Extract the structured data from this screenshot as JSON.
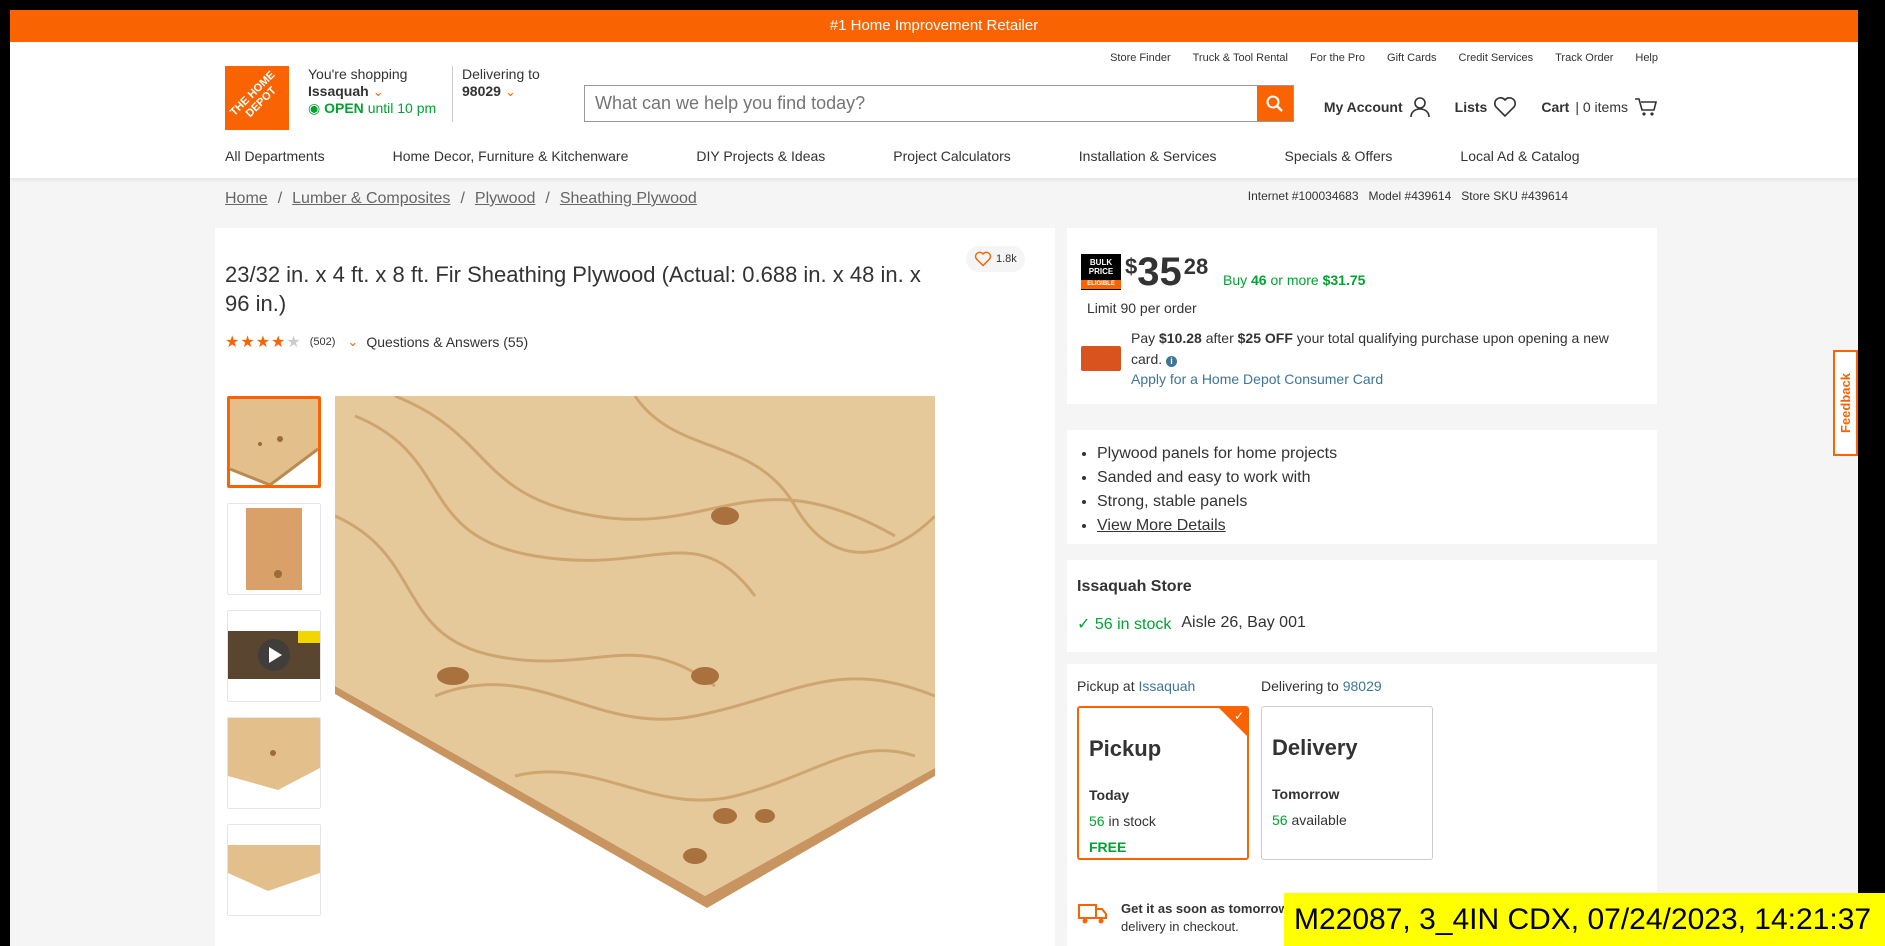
{
  "promo_banner": "#1 Home Improvement Retailer",
  "header": {
    "logo_text": "THE HOME DEPOT",
    "store": {
      "label": "You're shopping",
      "name": "Issaquah",
      "open": "OPEN",
      "hours": "until 10 pm"
    },
    "delivery": {
      "label": "Delivering to",
      "zip": "98029"
    },
    "search_placeholder": "What can we help you find today?",
    "utility_links": [
      "Store Finder",
      "Truck & Tool Rental",
      "For the Pro",
      "Gift Cards",
      "Credit Services",
      "Track Order",
      "Help"
    ],
    "my_account": "My Account",
    "lists": "Lists",
    "cart_label": "Cart",
    "cart_count": "| 0 items"
  },
  "nav": [
    "All Departments",
    "Home Decor, Furniture & Kitchenware",
    "DIY Projects & Ideas",
    "Project Calculators",
    "Installation & Services",
    "Specials & Offers",
    "Local Ad & Catalog"
  ],
  "breadcrumb": [
    "Home",
    "Lumber & Composites",
    "Plywood",
    "Sheathing Plywood"
  ],
  "skus": {
    "internet": "Internet #100034683",
    "model": "Model #439614",
    "store": "Store SKU #439614"
  },
  "product": {
    "title": "23/32 in. x 4 ft. x 8 ft. Fir Sheathing Plywood (Actual: 0.688 in. x 48 in. x 96 in.)",
    "favorites": "1.8k",
    "rating": 4,
    "review_count": "(502)",
    "qa": "Questions & Answers (55)"
  },
  "price": {
    "bulk_badge": [
      "BULK",
      "PRICE",
      "ELIGIBLE"
    ],
    "currency": "$",
    "dollars": "35",
    "cents": "28",
    "bulk_offer_prefix": "Buy",
    "bulk_qty": "46",
    "bulk_offer_mid": "or more",
    "bulk_price": "$31.75",
    "limit": "Limit 90 per order",
    "cc_pay": "Pay",
    "cc_amount": "$10.28",
    "cc_after": "after",
    "cc_off": "$25 OFF",
    "cc_rest": "your total qualifying purchase upon opening a new card.",
    "cc_link": "Apply for a Home Depot Consumer Card"
  },
  "bullets": [
    "Plywood panels for home projects",
    "Sanded and easy to work with",
    "Strong, stable panels"
  ],
  "view_more": "View More Details",
  "store_card": {
    "name": "Issaquah Store",
    "stock": "56 in stock",
    "aisle": "Aisle 26, Bay 001"
  },
  "fulfillment": {
    "pickup_label": "Pickup at",
    "pickup_store": "Issaquah",
    "delivery_label": "Delivering to",
    "delivery_zip": "98029",
    "pickup": {
      "title": "Pickup",
      "when": "Today",
      "count": "56",
      "count_suffix": "in stock",
      "cost": "FREE"
    },
    "delivery": {
      "title": "Delivery",
      "when": "Tomorrow",
      "count": "56",
      "count_suffix": "available"
    },
    "fast_bold": "Get it as soon as tomorrow",
    "fast_rest": "delivery in checkout."
  },
  "feedback_tab": "Feedback",
  "overlay_stamp": "M22087, 3_4IN CDX, 07/24/2023, 14:21:37",
  "colors": {
    "brand": "#f96302",
    "stock_green": "#00a330",
    "link_blue": "#3e7697"
  }
}
